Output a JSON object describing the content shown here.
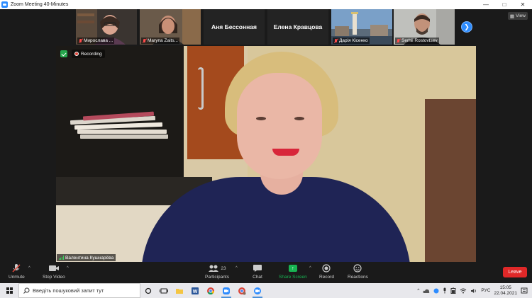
{
  "window": {
    "title": "Zoom Meeting 40-Minutes",
    "controls": [
      "minimize",
      "maximize",
      "close"
    ]
  },
  "gallery": {
    "tiles": [
      {
        "name": "Мирослава ...",
        "muted": true,
        "has_video": true
      },
      {
        "name": "Maryna Zaits...",
        "muted": true,
        "has_video": true
      },
      {
        "name": "Аня Бессонная",
        "muted": false,
        "has_video": false
      },
      {
        "name": "Елена Кравцова",
        "muted": false,
        "has_video": false
      },
      {
        "name": "Дарія Кісенко",
        "muted": true,
        "has_video": true
      },
      {
        "name": "Serhii Rostovtsev",
        "muted": true,
        "has_video": true
      }
    ],
    "next_icon": "chevron-right-icon",
    "view_label": "View"
  },
  "main_video": {
    "recording_label": "Recording",
    "speaker_name": "Валентина Кушнарёва"
  },
  "toolbar": {
    "unmute_label": "Unmute",
    "stop_video_label": "Stop Video",
    "participants_label": "Participants",
    "participants_count": "23",
    "chat_label": "Chat",
    "share_screen_label": "Share Screen",
    "record_label": "Record",
    "reactions_label": "Reactions",
    "leave_label": "Leave"
  },
  "taskbar": {
    "search_placeholder": "Введіть пошуковий запит тут",
    "language": "РУС",
    "time": "15:05",
    "date": "22.04.2021"
  },
  "colors": {
    "zoom_blue": "#2d8cff",
    "share_green": "#18b352",
    "leave_red": "#e02828",
    "toolbar_bg": "#1a1a1a"
  }
}
